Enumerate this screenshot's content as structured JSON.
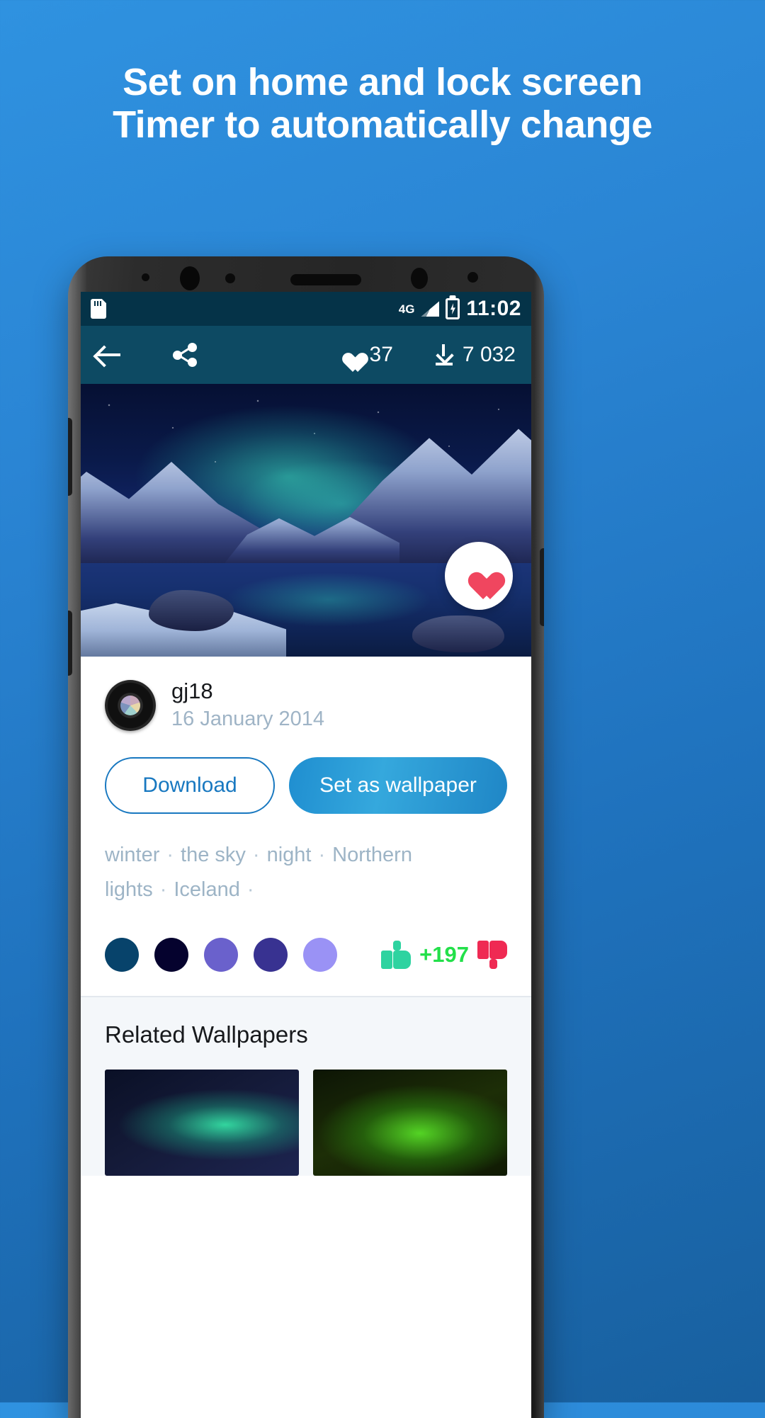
{
  "promo": {
    "headline_line1": "Set on home and lock screen",
    "headline_line2": "Timer to automatically change",
    "background_color": "#2a85d4"
  },
  "statusbar": {
    "sd_icon": "sd-card-icon",
    "network": "4G",
    "signal_icon": "signal-bars-icon",
    "battery_icon": "battery-charging-icon",
    "time": "11:02"
  },
  "toolbar": {
    "back_icon": "arrow-back-icon",
    "share_icon": "share-icon",
    "like_icon": "heart-icon",
    "like_count": "37",
    "download_icon": "download-icon",
    "download_count": "7 032",
    "background_color": "#0d4a63"
  },
  "hero": {
    "alt": "Aurora borealis over snowy mountains and a lake",
    "fab_icon": "heart-filled-icon",
    "fab_color": "#f0465f"
  },
  "details": {
    "avatar_icon": "camera-lens-avatar",
    "author": "gj18",
    "date": "16 January 2014",
    "download_label": "Download",
    "set_wallpaper_label": "Set as wallpaper",
    "download_color": "#1878c0",
    "set_wallpaper_color": "#2a9bd6",
    "tags": [
      "winter",
      "the sky",
      "night",
      "Northern lights",
      "Iceland"
    ],
    "tag_separator": "·",
    "palette": [
      "#07436b",
      "#05022e",
      "#6a61cc",
      "#383291",
      "#9a92f5"
    ],
    "vote": {
      "up_icon": "thumbs-up-icon",
      "down_icon": "thumbs-down-icon",
      "count": "+197",
      "up_color": "#2ed3a0",
      "down_color": "#ef2a53",
      "count_color": "#23e04a"
    }
  },
  "related": {
    "title": "Related Wallpapers",
    "items": [
      {
        "alt": "Green aurora over dark night sky"
      },
      {
        "alt": "Bright green aurora over dark landscape"
      }
    ]
  }
}
